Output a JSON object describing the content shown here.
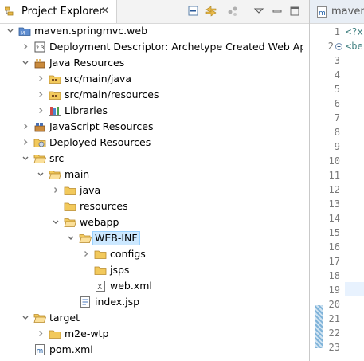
{
  "project_explorer": {
    "tab_title": "Project Explorer",
    "close_glyph": "✕",
    "toolbar": [
      "collapse-all-icon",
      "link-with-editor-icon",
      "focus-on-active-icon",
      "view-menu-icon",
      "minimize-icon",
      "maximize-icon"
    ],
    "tree": [
      {
        "label": "maven.springmvc.web",
        "icon": "maven-project-icon",
        "expanded": true,
        "depth": 0
      },
      {
        "label": "Deployment Descriptor: Archetype Created Web Ap",
        "icon": "deployment-descriptor-icon",
        "expanded": false,
        "depth": 1
      },
      {
        "label": "Java Resources",
        "icon": "java-resources-icon",
        "expanded": true,
        "depth": 1
      },
      {
        "label": "src/main/java",
        "icon": "source-folder-icon",
        "expanded": false,
        "depth": 2
      },
      {
        "label": "src/main/resources",
        "icon": "source-folder-icon",
        "expanded": false,
        "depth": 2
      },
      {
        "label": "Libraries",
        "icon": "libraries-icon",
        "expanded": false,
        "depth": 2
      },
      {
        "label": "JavaScript Resources",
        "icon": "javascript-resources-icon",
        "expanded": false,
        "depth": 1
      },
      {
        "label": "Deployed Resources",
        "icon": "deployed-resources-icon",
        "expanded": false,
        "depth": 1
      },
      {
        "label": "src",
        "icon": "folder-open-icon",
        "expanded": true,
        "depth": 1
      },
      {
        "label": "main",
        "icon": "folder-open-icon",
        "expanded": true,
        "depth": 2
      },
      {
        "label": "java",
        "icon": "folder-icon",
        "expanded": false,
        "depth": 3
      },
      {
        "label": "resources",
        "icon": "folder-icon",
        "expanded": null,
        "depth": 3
      },
      {
        "label": "webapp",
        "icon": "folder-open-icon",
        "expanded": true,
        "depth": 3
      },
      {
        "label": "WEB-INF",
        "icon": "folder-open-icon",
        "expanded": true,
        "depth": 4,
        "selected": true
      },
      {
        "label": "configs",
        "icon": "folder-icon",
        "expanded": false,
        "depth": 5
      },
      {
        "label": "jsps",
        "icon": "folder-icon",
        "expanded": null,
        "depth": 5
      },
      {
        "label": "web.xml",
        "icon": "xml-file-icon",
        "expanded": null,
        "depth": 5
      },
      {
        "label": "index.jsp",
        "icon": "jsp-file-icon",
        "expanded": null,
        "depth": 4
      },
      {
        "label": "target",
        "icon": "folder-open-icon",
        "expanded": true,
        "depth": 1
      },
      {
        "label": "m2e-wtp",
        "icon": "folder-icon",
        "expanded": false,
        "depth": 2
      },
      {
        "label": "pom.xml",
        "icon": "maven-pom-icon",
        "expanded": null,
        "depth": 1
      }
    ]
  },
  "editor": {
    "tab_title": "maven.",
    "line_numbers": [
      "1",
      "2",
      "3",
      "4",
      "5",
      "6",
      "7",
      "8",
      "9",
      "10",
      "11",
      "12",
      "13",
      "14",
      "15",
      "16",
      "17",
      "18",
      "19",
      "20",
      "21",
      "22",
      "23"
    ],
    "code_lines": [
      "<?x",
      "<be"
    ]
  },
  "colors": {
    "selection_bg": "#cce8ff",
    "folder": "#e8b84a",
    "current_line": "#e8f2fe"
  }
}
